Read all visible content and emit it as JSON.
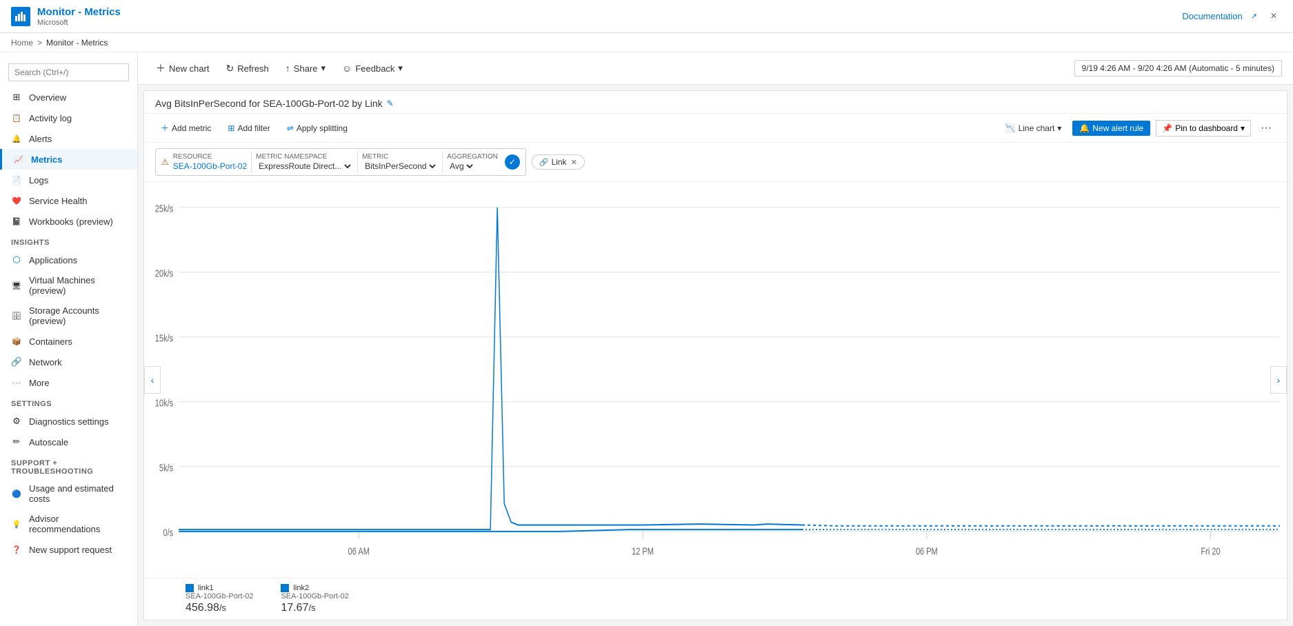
{
  "app": {
    "icon": "📊",
    "title": "Monitor - Metrics",
    "subtitle": "Microsoft",
    "doc_link": "Documentation",
    "close_label": "×"
  },
  "breadcrumb": {
    "home": "Home",
    "separator": ">",
    "current": "Monitor - Metrics"
  },
  "sidebar": {
    "search_placeholder": "Search (Ctrl+/)",
    "collapse_icon": "«",
    "items": [
      {
        "id": "overview",
        "label": "Overview",
        "icon": "⊞",
        "active": false
      },
      {
        "id": "activity-log",
        "label": "Activity log",
        "icon": "📋",
        "active": false
      },
      {
        "id": "alerts",
        "label": "Alerts",
        "icon": "🔔",
        "active": false
      },
      {
        "id": "metrics",
        "label": "Metrics",
        "icon": "📈",
        "active": true
      },
      {
        "id": "logs",
        "label": "Logs",
        "icon": "📄",
        "active": false
      },
      {
        "id": "service-health",
        "label": "Service Health",
        "icon": "❤️",
        "active": false
      },
      {
        "id": "workbooks",
        "label": "Workbooks (preview)",
        "icon": "📓",
        "active": false
      }
    ],
    "insights_label": "Insights",
    "insights_items": [
      {
        "id": "applications",
        "label": "Applications",
        "icon": "⬡"
      },
      {
        "id": "virtual-machines",
        "label": "Virtual Machines (preview)",
        "icon": "🖥"
      },
      {
        "id": "storage-accounts",
        "label": "Storage Accounts (preview)",
        "icon": "🗄"
      },
      {
        "id": "containers",
        "label": "Containers",
        "icon": "📦"
      },
      {
        "id": "network",
        "label": "Network",
        "icon": "🔗"
      },
      {
        "id": "more",
        "label": "More",
        "icon": "···"
      }
    ],
    "settings_label": "Settings",
    "settings_items": [
      {
        "id": "diagnostics",
        "label": "Diagnostics settings",
        "icon": "⚙"
      },
      {
        "id": "autoscale",
        "label": "Autoscale",
        "icon": "✏"
      }
    ],
    "support_label": "Support + Troubleshooting",
    "support_items": [
      {
        "id": "usage-costs",
        "label": "Usage and estimated costs",
        "icon": "🔵"
      },
      {
        "id": "advisor",
        "label": "Advisor recommendations",
        "icon": "💡"
      },
      {
        "id": "support-request",
        "label": "New support request",
        "icon": "❓"
      }
    ]
  },
  "toolbar": {
    "new_chart": "New chart",
    "refresh": "Refresh",
    "share": "Share",
    "feedback": "Feedback",
    "time_range": "9/19 4:26 AM - 9/20 4:26 AM (Automatic - 5 minutes)"
  },
  "chart": {
    "title": "Avg BitsInPerSecond for SEA-100Gb-Port-02 by Link",
    "add_metric": "Add metric",
    "add_filter": "Add filter",
    "apply_splitting": "Apply splitting",
    "chart_type": "Line chart",
    "new_alert_rule": "New alert rule",
    "pin_to_dashboard": "Pin to dashboard",
    "more_options": "···",
    "resource": {
      "label": "RESOURCE",
      "value": "SEA-100Gb-Port-02"
    },
    "metric_namespace": {
      "label": "METRIC NAMESPACE",
      "value": "ExpressRoute Direct..."
    },
    "metric": {
      "label": "METRIC",
      "value": "BitsInPerSecond"
    },
    "aggregation": {
      "label": "AGGREGATION",
      "value": "Avg"
    },
    "link_tag": "Link",
    "y_axis": {
      "labels": [
        "25k/s",
        "20k/s",
        "15k/s",
        "10k/s",
        "5k/s",
        "0/s"
      ]
    },
    "x_axis": {
      "labels": [
        "06 AM",
        "12 PM",
        "06 PM",
        "Fri 20"
      ]
    },
    "legend": [
      {
        "id": "link1",
        "color": "#0078d4",
        "label1": "link1",
        "label2": "SEA-100Gb-Port-02",
        "value": "456.98",
        "unit": "/s"
      },
      {
        "id": "link2",
        "color": "#0078d4",
        "label1": "link2",
        "label2": "SEA-100Gb-Port-02",
        "value": "17.67",
        "unit": "/s"
      }
    ]
  }
}
